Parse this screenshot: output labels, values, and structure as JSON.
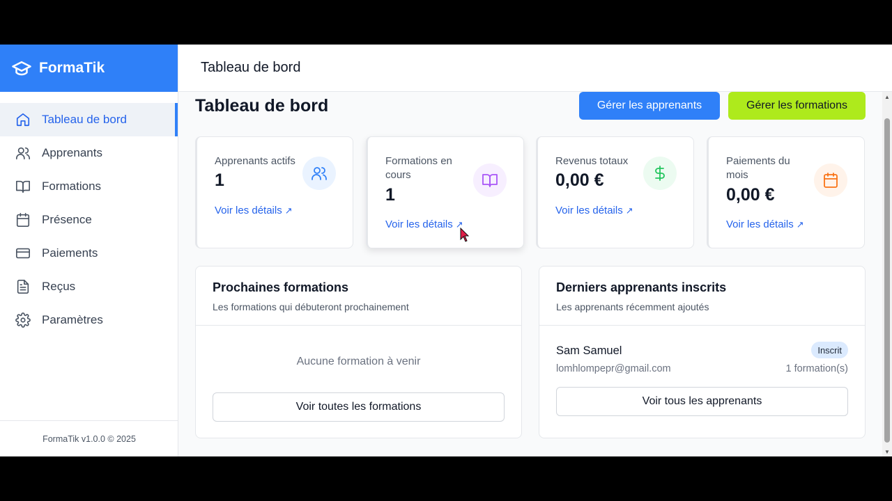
{
  "app": {
    "name": "FormaTik",
    "version_footer": "FormaTik v1.0.0 © 2025"
  },
  "header": {
    "title": "Tableau de bord"
  },
  "sidebar": {
    "items": [
      {
        "label": "Tableau de bord",
        "icon": "home-icon",
        "active": true
      },
      {
        "label": "Apprenants",
        "icon": "users-icon"
      },
      {
        "label": "Formations",
        "icon": "book-icon"
      },
      {
        "label": "Présence",
        "icon": "calendar-icon"
      },
      {
        "label": "Paiements",
        "icon": "credit-card-icon"
      },
      {
        "label": "Reçus",
        "icon": "receipt-icon"
      },
      {
        "label": "Paramètres",
        "icon": "gear-icon"
      }
    ]
  },
  "main": {
    "title": "Tableau de bord",
    "buttons": {
      "manage_students": "Gérer les apprenants",
      "manage_courses": "Gérer les formations"
    },
    "stats": [
      {
        "label": "Apprenants actifs",
        "value": "1",
        "link": "Voir les détails",
        "icon": "users-icon",
        "color": "#2f80f8"
      },
      {
        "label": "Formations en cours",
        "value": "1",
        "link": "Voir les détails",
        "icon": "book-open-icon",
        "color": "#a855f7"
      },
      {
        "label": "Revenus totaux",
        "value": "0,00 €",
        "link": "Voir les détails",
        "icon": "dollar-icon",
        "color": "#22c55e"
      },
      {
        "label": "Paiements du mois",
        "value": "0,00 €",
        "link": "Voir les détails",
        "icon": "calendar-icon",
        "color": "#f97316"
      }
    ],
    "upcoming": {
      "title": "Prochaines formations",
      "subtitle": "Les formations qui débuteront prochainement",
      "empty": "Aucune formation à venir",
      "button": "Voir toutes les formations"
    },
    "recent": {
      "title": "Derniers apprenants inscrits",
      "subtitle": "Les apprenants récemment ajoutés",
      "students": [
        {
          "name": "Sam Samuel",
          "email": "lomhlompepr@gmail.com",
          "badge": "Inscrit",
          "count": "1 formation(s)"
        }
      ],
      "button": "Voir tous les apprenants"
    }
  },
  "colors": {
    "accent": "#2f80f8",
    "lime": "#aeea1c"
  }
}
